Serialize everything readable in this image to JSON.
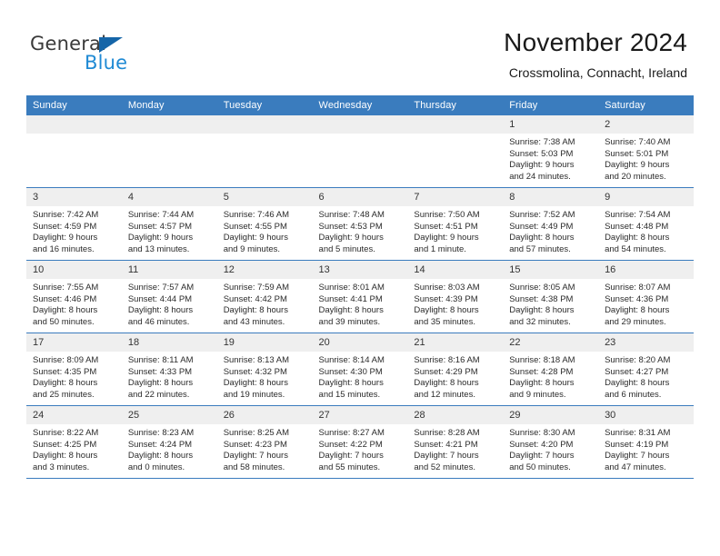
{
  "brand": {
    "name_part1": "General",
    "name_part2": "Blue",
    "triangle_color": "#1565a8",
    "blue_color": "#1f8ad4"
  },
  "header": {
    "title": "November 2024",
    "subtitle": "Crossmolina, Connacht, Ireland",
    "accent_color": "#3a7cbe",
    "daynum_bg": "#efefef"
  },
  "weekday_headers": [
    "Sunday",
    "Monday",
    "Tuesday",
    "Wednesday",
    "Thursday",
    "Friday",
    "Saturday"
  ],
  "weeks": [
    [
      {
        "day": "",
        "empty": true,
        "sunrise": "",
        "sunset": "",
        "daylight1": "",
        "daylight2": ""
      },
      {
        "day": "",
        "empty": true,
        "sunrise": "",
        "sunset": "",
        "daylight1": "",
        "daylight2": ""
      },
      {
        "day": "",
        "empty": true,
        "sunrise": "",
        "sunset": "",
        "daylight1": "",
        "daylight2": ""
      },
      {
        "day": "",
        "empty": true,
        "sunrise": "",
        "sunset": "",
        "daylight1": "",
        "daylight2": ""
      },
      {
        "day": "",
        "empty": true,
        "sunrise": "",
        "sunset": "",
        "daylight1": "",
        "daylight2": ""
      },
      {
        "day": "1",
        "empty": false,
        "sunrise": "Sunrise: 7:38 AM",
        "sunset": "Sunset: 5:03 PM",
        "daylight1": "Daylight: 9 hours",
        "daylight2": "and 24 minutes."
      },
      {
        "day": "2",
        "empty": false,
        "sunrise": "Sunrise: 7:40 AM",
        "sunset": "Sunset: 5:01 PM",
        "daylight1": "Daylight: 9 hours",
        "daylight2": "and 20 minutes."
      }
    ],
    [
      {
        "day": "3",
        "empty": false,
        "sunrise": "Sunrise: 7:42 AM",
        "sunset": "Sunset: 4:59 PM",
        "daylight1": "Daylight: 9 hours",
        "daylight2": "and 16 minutes."
      },
      {
        "day": "4",
        "empty": false,
        "sunrise": "Sunrise: 7:44 AM",
        "sunset": "Sunset: 4:57 PM",
        "daylight1": "Daylight: 9 hours",
        "daylight2": "and 13 minutes."
      },
      {
        "day": "5",
        "empty": false,
        "sunrise": "Sunrise: 7:46 AM",
        "sunset": "Sunset: 4:55 PM",
        "daylight1": "Daylight: 9 hours",
        "daylight2": "and 9 minutes."
      },
      {
        "day": "6",
        "empty": false,
        "sunrise": "Sunrise: 7:48 AM",
        "sunset": "Sunset: 4:53 PM",
        "daylight1": "Daylight: 9 hours",
        "daylight2": "and 5 minutes."
      },
      {
        "day": "7",
        "empty": false,
        "sunrise": "Sunrise: 7:50 AM",
        "sunset": "Sunset: 4:51 PM",
        "daylight1": "Daylight: 9 hours",
        "daylight2": "and 1 minute."
      },
      {
        "day": "8",
        "empty": false,
        "sunrise": "Sunrise: 7:52 AM",
        "sunset": "Sunset: 4:49 PM",
        "daylight1": "Daylight: 8 hours",
        "daylight2": "and 57 minutes."
      },
      {
        "day": "9",
        "empty": false,
        "sunrise": "Sunrise: 7:54 AM",
        "sunset": "Sunset: 4:48 PM",
        "daylight1": "Daylight: 8 hours",
        "daylight2": "and 54 minutes."
      }
    ],
    [
      {
        "day": "10",
        "empty": false,
        "sunrise": "Sunrise: 7:55 AM",
        "sunset": "Sunset: 4:46 PM",
        "daylight1": "Daylight: 8 hours",
        "daylight2": "and 50 minutes."
      },
      {
        "day": "11",
        "empty": false,
        "sunrise": "Sunrise: 7:57 AM",
        "sunset": "Sunset: 4:44 PM",
        "daylight1": "Daylight: 8 hours",
        "daylight2": "and 46 minutes."
      },
      {
        "day": "12",
        "empty": false,
        "sunrise": "Sunrise: 7:59 AM",
        "sunset": "Sunset: 4:42 PM",
        "daylight1": "Daylight: 8 hours",
        "daylight2": "and 43 minutes."
      },
      {
        "day": "13",
        "empty": false,
        "sunrise": "Sunrise: 8:01 AM",
        "sunset": "Sunset: 4:41 PM",
        "daylight1": "Daylight: 8 hours",
        "daylight2": "and 39 minutes."
      },
      {
        "day": "14",
        "empty": false,
        "sunrise": "Sunrise: 8:03 AM",
        "sunset": "Sunset: 4:39 PM",
        "daylight1": "Daylight: 8 hours",
        "daylight2": "and 35 minutes."
      },
      {
        "day": "15",
        "empty": false,
        "sunrise": "Sunrise: 8:05 AM",
        "sunset": "Sunset: 4:38 PM",
        "daylight1": "Daylight: 8 hours",
        "daylight2": "and 32 minutes."
      },
      {
        "day": "16",
        "empty": false,
        "sunrise": "Sunrise: 8:07 AM",
        "sunset": "Sunset: 4:36 PM",
        "daylight1": "Daylight: 8 hours",
        "daylight2": "and 29 minutes."
      }
    ],
    [
      {
        "day": "17",
        "empty": false,
        "sunrise": "Sunrise: 8:09 AM",
        "sunset": "Sunset: 4:35 PM",
        "daylight1": "Daylight: 8 hours",
        "daylight2": "and 25 minutes."
      },
      {
        "day": "18",
        "empty": false,
        "sunrise": "Sunrise: 8:11 AM",
        "sunset": "Sunset: 4:33 PM",
        "daylight1": "Daylight: 8 hours",
        "daylight2": "and 22 minutes."
      },
      {
        "day": "19",
        "empty": false,
        "sunrise": "Sunrise: 8:13 AM",
        "sunset": "Sunset: 4:32 PM",
        "daylight1": "Daylight: 8 hours",
        "daylight2": "and 19 minutes."
      },
      {
        "day": "20",
        "empty": false,
        "sunrise": "Sunrise: 8:14 AM",
        "sunset": "Sunset: 4:30 PM",
        "daylight1": "Daylight: 8 hours",
        "daylight2": "and 15 minutes."
      },
      {
        "day": "21",
        "empty": false,
        "sunrise": "Sunrise: 8:16 AM",
        "sunset": "Sunset: 4:29 PM",
        "daylight1": "Daylight: 8 hours",
        "daylight2": "and 12 minutes."
      },
      {
        "day": "22",
        "empty": false,
        "sunrise": "Sunrise: 8:18 AM",
        "sunset": "Sunset: 4:28 PM",
        "daylight1": "Daylight: 8 hours",
        "daylight2": "and 9 minutes."
      },
      {
        "day": "23",
        "empty": false,
        "sunrise": "Sunrise: 8:20 AM",
        "sunset": "Sunset: 4:27 PM",
        "daylight1": "Daylight: 8 hours",
        "daylight2": "and 6 minutes."
      }
    ],
    [
      {
        "day": "24",
        "empty": false,
        "sunrise": "Sunrise: 8:22 AM",
        "sunset": "Sunset: 4:25 PM",
        "daylight1": "Daylight: 8 hours",
        "daylight2": "and 3 minutes."
      },
      {
        "day": "25",
        "empty": false,
        "sunrise": "Sunrise: 8:23 AM",
        "sunset": "Sunset: 4:24 PM",
        "daylight1": "Daylight: 8 hours",
        "daylight2": "and 0 minutes."
      },
      {
        "day": "26",
        "empty": false,
        "sunrise": "Sunrise: 8:25 AM",
        "sunset": "Sunset: 4:23 PM",
        "daylight1": "Daylight: 7 hours",
        "daylight2": "and 58 minutes."
      },
      {
        "day": "27",
        "empty": false,
        "sunrise": "Sunrise: 8:27 AM",
        "sunset": "Sunset: 4:22 PM",
        "daylight1": "Daylight: 7 hours",
        "daylight2": "and 55 minutes."
      },
      {
        "day": "28",
        "empty": false,
        "sunrise": "Sunrise: 8:28 AM",
        "sunset": "Sunset: 4:21 PM",
        "daylight1": "Daylight: 7 hours",
        "daylight2": "and 52 minutes."
      },
      {
        "day": "29",
        "empty": false,
        "sunrise": "Sunrise: 8:30 AM",
        "sunset": "Sunset: 4:20 PM",
        "daylight1": "Daylight: 7 hours",
        "daylight2": "and 50 minutes."
      },
      {
        "day": "30",
        "empty": false,
        "sunrise": "Sunrise: 8:31 AM",
        "sunset": "Sunset: 4:19 PM",
        "daylight1": "Daylight: 7 hours",
        "daylight2": "and 47 minutes."
      }
    ]
  ]
}
